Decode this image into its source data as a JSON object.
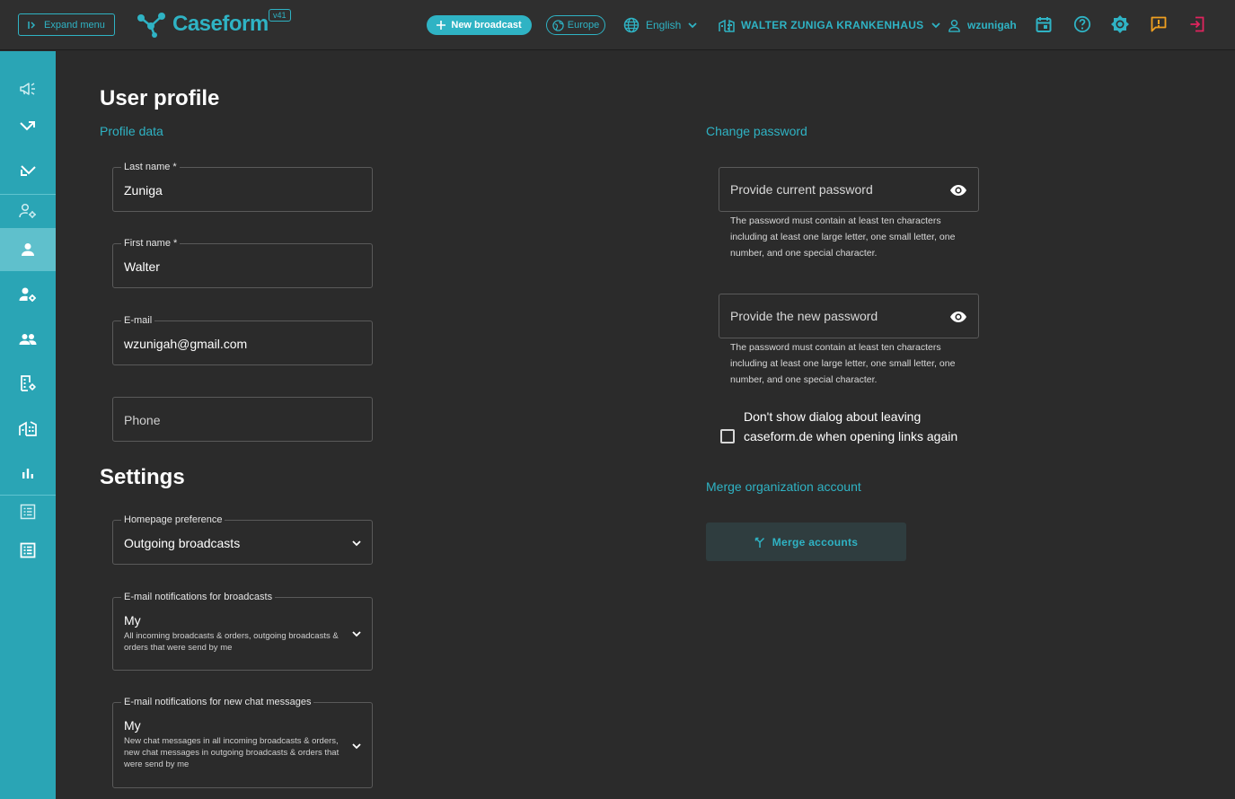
{
  "header": {
    "expand_menu_label": "Expand menu",
    "logo_text": "Caseform",
    "version": "v41",
    "new_broadcast_label": "New broadcast",
    "region_label": "Europe",
    "language_label": "English",
    "organization_label": "WALTER ZUNIGA KRANKENHAUS",
    "username": "wzunigah",
    "accent_color": "#2fb3c4",
    "warning_color": "#f0a020",
    "logout_color": "#e0245e"
  },
  "sidebar": {
    "items": [
      {
        "icon": "megaphone-icon"
      },
      {
        "icon": "outgoing-arrow-icon"
      },
      {
        "icon": "incoming-arrow-icon"
      },
      {
        "icon": "user-settings-icon"
      },
      {
        "icon": "person-icon",
        "active": true
      },
      {
        "icon": "user-gear-icon"
      },
      {
        "icon": "group-icon"
      },
      {
        "icon": "building-gear-icon"
      },
      {
        "icon": "building-icon"
      },
      {
        "icon": "bar-chart-icon"
      },
      {
        "icon": "list-icon"
      },
      {
        "icon": "list-alt-icon"
      }
    ]
  },
  "profile": {
    "title": "User profile",
    "section_label": "Profile data",
    "last_name_label": "Last name *",
    "last_name_value": "Zuniga",
    "first_name_label": "First name *",
    "first_name_value": "Walter",
    "email_label": "E-mail",
    "email_value": "wzunigah@gmail.com",
    "phone_placeholder": "Phone"
  },
  "settings": {
    "title": "Settings",
    "homepage_label": "Homepage preference",
    "homepage_value": "Outgoing broadcasts",
    "email_broadcasts_label": "E-mail notifications for broadcasts",
    "email_broadcasts_value": "My",
    "email_broadcasts_desc": "All incoming broadcasts & orders, outgoing broadcasts & orders that were send by me",
    "email_chat_label": "E-mail notifications for new chat messages",
    "email_chat_value": "My",
    "email_chat_desc": "New chat messages in all incoming broadcasts & orders, new chat messages in outgoing broadcasts & orders that were send by me"
  },
  "password": {
    "section_label": "Change password",
    "current_placeholder": "Provide current password",
    "current_hint": "The password must contain at least ten characters including at least one large letter, one small letter, one number, and one special character.",
    "new_placeholder": "Provide the new password",
    "new_hint": "The password must contain at least ten characters including at least one large letter, one small letter, one number, and one special character.",
    "dialog_checkbox_label": "Don't show dialog about leaving caseform.de when opening links again",
    "dialog_checkbox_checked": false
  },
  "merge": {
    "section_label": "Merge organization account",
    "button_label": "Merge accounts"
  }
}
